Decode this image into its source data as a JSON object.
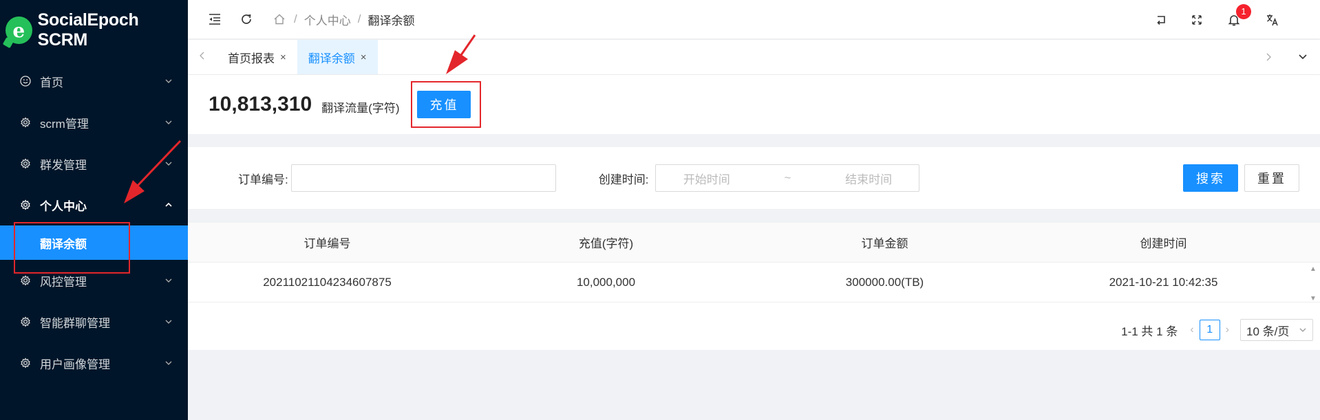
{
  "app": {
    "name": "SocialEpoch SCRM",
    "logo_letter": "e"
  },
  "sidebar": {
    "items": [
      {
        "label": "首页",
        "icon": "smile-icon"
      },
      {
        "label": "scrm管理",
        "icon": "gear-icon"
      },
      {
        "label": "群发管理",
        "icon": "gear-icon"
      },
      {
        "label": "个人中心",
        "icon": "gear-icon"
      },
      {
        "label": "风控管理",
        "icon": "gear-icon"
      },
      {
        "label": "智能群聊管理",
        "icon": "gear-icon"
      },
      {
        "label": "用户画像管理",
        "icon": "gear-icon"
      }
    ],
    "sub_item": "翻译余额"
  },
  "header": {
    "breadcrumb": [
      "个人中心",
      "翻译余额"
    ],
    "notification_count": "1"
  },
  "tabs": [
    {
      "label": "首页报表",
      "close": "×"
    },
    {
      "label": "翻译余额",
      "close": "×"
    }
  ],
  "balance": {
    "value": "10,813,310",
    "label": "翻译流量(字符)",
    "recharge_label": "充值"
  },
  "search": {
    "order_label": "订单编号:",
    "order_value": "",
    "time_label": "创建时间:",
    "start_placeholder": "开始时间",
    "range_sep": "~",
    "end_placeholder": "结束时间",
    "search_label": "搜索",
    "reset_label": "重置"
  },
  "table": {
    "columns": [
      "订单编号",
      "充值(字符)",
      "订单金额",
      "创建时间"
    ],
    "rows": [
      [
        "20211021104234607875",
        "10,000,000",
        "300000.00(TB)",
        "2021-10-21 10:42:35"
      ]
    ]
  },
  "pagination": {
    "summary": "1-1 共 1 条",
    "current_page": "1",
    "page_size": "10 条/页"
  },
  "colors": {
    "primary": "#1890ff",
    "sidebar_bg": "#001529",
    "annotation": "#e3262b",
    "badge": "#f5222d"
  }
}
